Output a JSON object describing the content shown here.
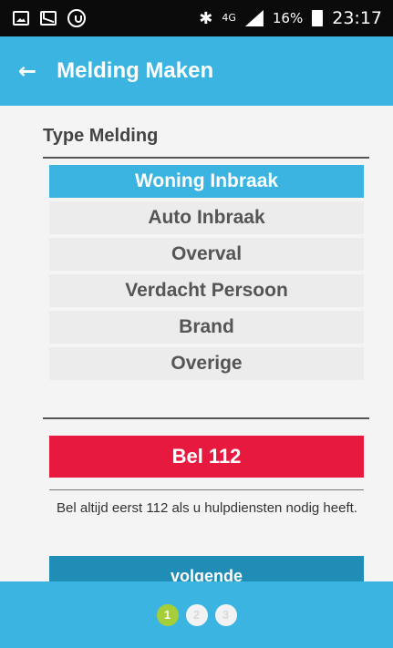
{
  "status_bar": {
    "icons": [
      "image-icon",
      "mail-icon",
      "sync-icon",
      "bluetooth-icon",
      "signal-icon",
      "battery-icon"
    ],
    "network": "4G",
    "battery": "16%",
    "time": "23:17"
  },
  "app_bar": {
    "back_icon": "←",
    "title": "Melding Maken"
  },
  "main": {
    "section_title": "Type Melding",
    "types": [
      {
        "label": "Woning Inbraak",
        "selected": true
      },
      {
        "label": "Auto Inbraak",
        "selected": false
      },
      {
        "label": "Overval",
        "selected": false
      },
      {
        "label": "Verdacht Persoon",
        "selected": false
      },
      {
        "label": "Brand",
        "selected": false
      },
      {
        "label": "Overige",
        "selected": false
      }
    ],
    "call_button": "Bel 112",
    "info_text": "Bel altijd eerst 112 als u hulpdiensten nodig heeft.",
    "next_button": "volgende"
  },
  "steps": {
    "items": [
      "1",
      "2",
      "3"
    ],
    "active": 1
  },
  "colors": {
    "primary": "#3bb4e1",
    "danger": "#e8193f",
    "next": "#1f8db5",
    "step_active": "#a6ce39"
  }
}
